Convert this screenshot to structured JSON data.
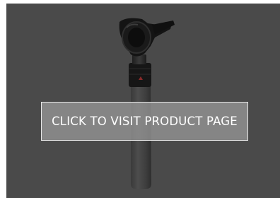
{
  "product_card": {
    "image_name": "otoscope-product-image",
    "overlay": {
      "label": "CLICK TO VISIT PRODUCT PAGE"
    },
    "colors": {
      "background": "#4a4a4a",
      "overlay_fill": "#969696",
      "overlay_border": "#e8e8e8",
      "text": "#ffffff",
      "indicator": "#8a2a2a"
    }
  }
}
